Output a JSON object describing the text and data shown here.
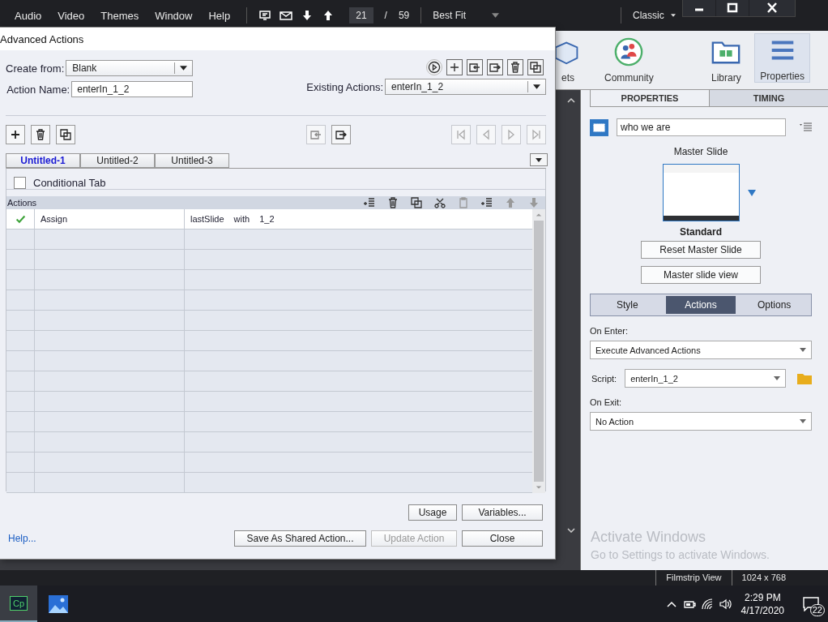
{
  "menu": [
    {
      "label": "Audio"
    },
    {
      "label": "Video"
    },
    {
      "label": "Themes"
    },
    {
      "label": "Window"
    },
    {
      "label": "Help"
    }
  ],
  "toolbar": {
    "current_slide": "21",
    "separator": "/",
    "total_slides": "59",
    "zoom": "Best Fit",
    "workspace": "Classic"
  },
  "app_toolbar": [
    {
      "label": "ets",
      "kind": "assets",
      "selected": false
    },
    {
      "label": "Community",
      "kind": "community",
      "selected": false
    },
    {
      "label": "Library",
      "kind": "library",
      "selected": false
    },
    {
      "label": "Properties",
      "kind": "properties",
      "selected": true
    }
  ],
  "panel_tabs": [
    {
      "label": "PROPERTIES",
      "selected": true
    },
    {
      "label": "TIMING",
      "selected": false
    }
  ],
  "properties": {
    "slide_name": "who we are",
    "master_label": "Master Slide",
    "master_name": "Standard",
    "buttons": [
      "Reset Master Slide",
      "Master slide view"
    ],
    "subtabs": [
      {
        "label": "Style",
        "selected": false
      },
      {
        "label": "Actions",
        "selected": true
      },
      {
        "label": "Options",
        "selected": false
      }
    ],
    "on_enter_label": "On Enter:",
    "on_enter": "Execute Advanced Actions",
    "script_label": "Script:",
    "script": "enterIn_1_2",
    "on_exit_label": "On Exit:",
    "on_exit": "No Action"
  },
  "dialog": {
    "title": "Advanced Actions",
    "create_from_label": "Create from:",
    "create_from": "Blank",
    "action_name_label": "Action Name:",
    "action_name": "enterIn_1_2",
    "existing_label": "Existing Actions:",
    "existing": "enterIn_1_2",
    "tabs": [
      {
        "label": "Untitled-1",
        "selected": true
      },
      {
        "label": "Untitled-2",
        "selected": false
      },
      {
        "label": "Untitled-3",
        "selected": false
      }
    ],
    "conditional": {
      "label": "Conditional Tab",
      "checked": false
    },
    "actions_label": "Actions",
    "rows": [
      {
        "checked": true,
        "action": "Assign",
        "variable": "lastSlide",
        "operator": "with",
        "value": "1_2"
      }
    ],
    "usage": "Usage",
    "variables": "Variables...",
    "help": "Help...",
    "buttons": [
      {
        "label": "Save As Shared Action...",
        "disabled": false
      },
      {
        "label": "Update Action",
        "disabled": true
      },
      {
        "label": "Close",
        "disabled": false
      }
    ]
  },
  "status": [
    "Filmstrip View",
    "1024 x 768"
  ],
  "watermark": {
    "title": "Activate Windows",
    "subtitle": "Go to Settings to activate Windows."
  },
  "taskbar": {
    "app_label": "Cp",
    "time": "2:29 PM",
    "date": "4/17/2020",
    "notifications": "22"
  }
}
